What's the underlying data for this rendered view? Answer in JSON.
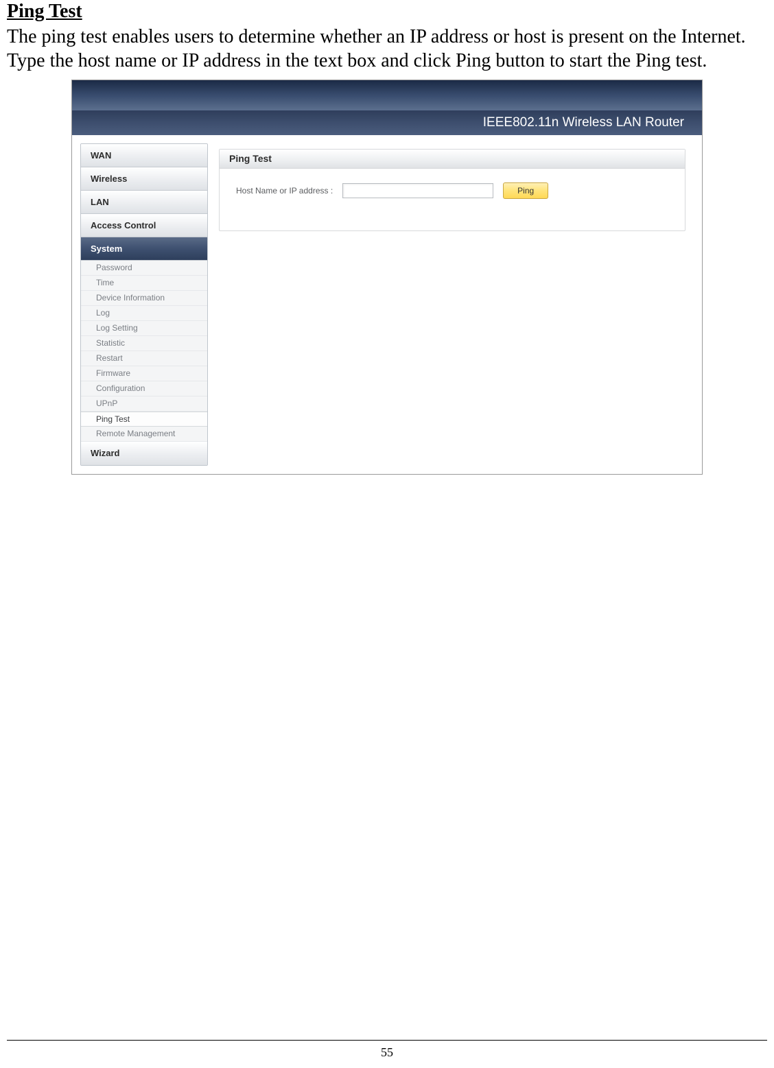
{
  "doc": {
    "heading": "Ping Test",
    "paragraph": "The ping test enables users to determine whether an IP address or host is present on the Internet. Type the host name or IP address in the text box and click Ping button to start the Ping test.",
    "page_number": "55"
  },
  "router": {
    "title": "IEEE802.11n  Wireless LAN Router",
    "nav": {
      "wan": "WAN",
      "wireless": "Wireless",
      "lan": "LAN",
      "access_control": "Access Control",
      "system": "System",
      "wizard": "Wizard"
    },
    "system_sub": {
      "password": "Password",
      "time": "Time",
      "device_info": "Device Information",
      "log": "Log",
      "log_setting": "Log Setting",
      "statistic": "Statistic",
      "restart": "Restart",
      "firmware": "Firmware",
      "configuration": "Configuration",
      "upnp": "UPnP",
      "ping_test": "Ping Test",
      "remote_mgmt": "Remote Management"
    },
    "panel": {
      "title": "Ping Test",
      "field_label": "Host Name or IP address :",
      "input_value": "",
      "button": "Ping"
    }
  }
}
